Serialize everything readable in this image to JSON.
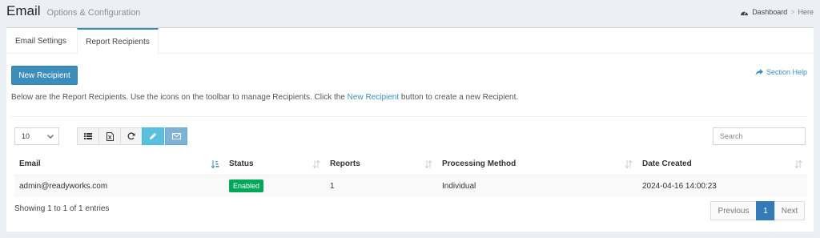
{
  "header": {
    "title": "Email",
    "subtitle": "Options & Configuration",
    "breadcrumb": {
      "dashboard": "Dashboard",
      "separator": ">",
      "here": "Here"
    }
  },
  "tabs": [
    {
      "label": "Email Settings",
      "active": false
    },
    {
      "label": "Report Recipients",
      "active": true
    }
  ],
  "actions": {
    "new_recipient": "New Recipient",
    "section_help": "Section Help"
  },
  "intro": {
    "before": "Below are the Report Recipients. Use the icons on the toolbar to manage Recipients. Click the ",
    "link": "New Recipient",
    "after": " button to create a new Recipient."
  },
  "table_controls": {
    "page_length": "10",
    "search_placeholder": "Search",
    "toolbar_icons": [
      "list-icon",
      "excel-icon",
      "refresh-icon",
      "pencil-icon",
      "envelope-icon"
    ]
  },
  "table": {
    "columns": [
      "Email",
      "Status",
      "Reports",
      "Processing Method",
      "Date Created"
    ],
    "rows": [
      {
        "email": "admin@readyworks.com",
        "status": "Enabled",
        "reports": "1",
        "method": "Individual",
        "created": "2024-04-16 14:00:23"
      }
    ]
  },
  "footer": {
    "info": "Showing 1 to 1 of 1 entries",
    "pagination": {
      "previous": "Previous",
      "current": "1",
      "next": "Next"
    }
  },
  "colors": {
    "primary": "#3c8dbc",
    "success": "#00a65a",
    "info": "#5bc0de",
    "page_active": "#337ab7"
  }
}
